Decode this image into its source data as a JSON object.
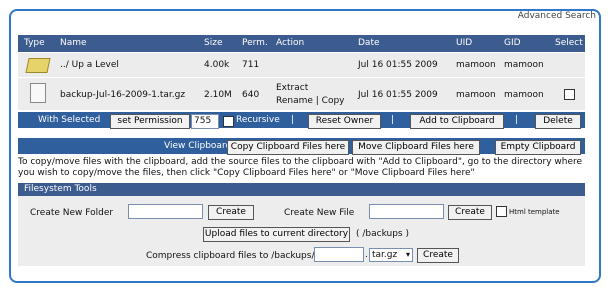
{
  "advanced_search": "Advanced Search",
  "table": {
    "columns": [
      "Type",
      "Name",
      "Size",
      "Perm.",
      "Action",
      "Date",
      "UID",
      "GID",
      "Select"
    ],
    "rows": [
      {
        "name": "../ Up a Level",
        "size": "4.00k",
        "perm": "711",
        "action1": "",
        "action2": "",
        "date": "Jul 16 01:55 2009",
        "uid": "mamoon",
        "gid": "mamoon"
      },
      {
        "name": "backup-Jul-16-2009-1.tar.gz",
        "size": "2.10M",
        "perm": "640",
        "action1": "Extract",
        "action2": "Rename | Copy",
        "date": "Jul 16 01:55 2009",
        "uid": "mamoon",
        "gid": "mamoon"
      }
    ]
  },
  "with_selected": {
    "label": "With Selected",
    "set_permission": "set Permission",
    "perm_value": "755",
    "recursive": "Recursive",
    "reset_owner": "Reset Owner",
    "add_clipboard": "Add to Clipboard",
    "delete": "Delete",
    "sep": "|"
  },
  "clipboard": {
    "view": "View Clipboard",
    "copy": "Copy Clipboard Files here",
    "move": "Move Clipboard Files here",
    "empty": "Empty Clipboard"
  },
  "instructions": "To copy/move files with the clipboard, add the source files to the clipboard with \"Add to Clipboard\", go to the directory where you wish to copy/move the files, then click \"Copy Clipboard Files here\" or \"Move Clipboard Files here\"",
  "tools": {
    "title": "Filesystem Tools",
    "new_folder_label": "Create New Folder",
    "create": "Create",
    "new_file_label": "Create New File",
    "html_template": "Html template",
    "upload": "Upload files to current directory",
    "upload_path": "( /backups )",
    "compress_label": "Compress clipboard files to /backups/",
    "compress_dot": ".",
    "compress_format": "tar.gz"
  }
}
